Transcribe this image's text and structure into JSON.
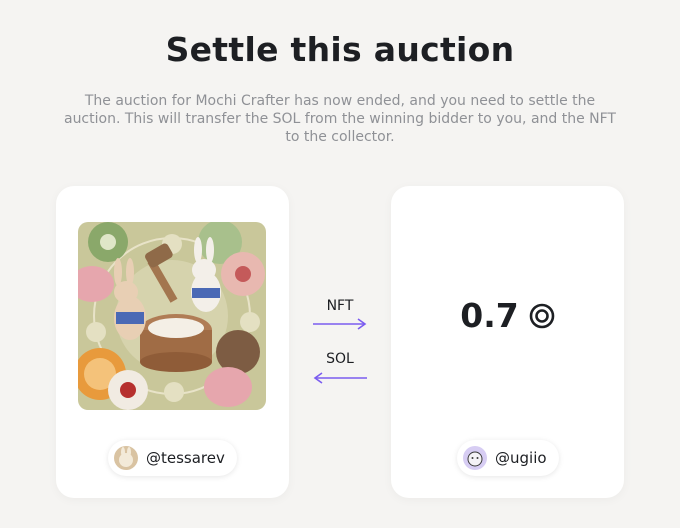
{
  "page": {
    "title": "Settle this auction",
    "description": "The auction for Mochi Crafter has now ended, and you need to settle the auction. This will transfer the SOL from the winning bidder to you, and the NFT to the collector."
  },
  "seller": {
    "username": "@tessarev",
    "avatar_icon": "seller-avatar"
  },
  "bidder": {
    "username": "@ugiio",
    "avatar_icon": "bidder-avatar"
  },
  "bid": {
    "amount": "0.7",
    "currency_icon": "sol-icon"
  },
  "transfer": {
    "nft_label": "NFT",
    "sol_label": "SOL",
    "arrow_color": "#7b5cf0"
  }
}
